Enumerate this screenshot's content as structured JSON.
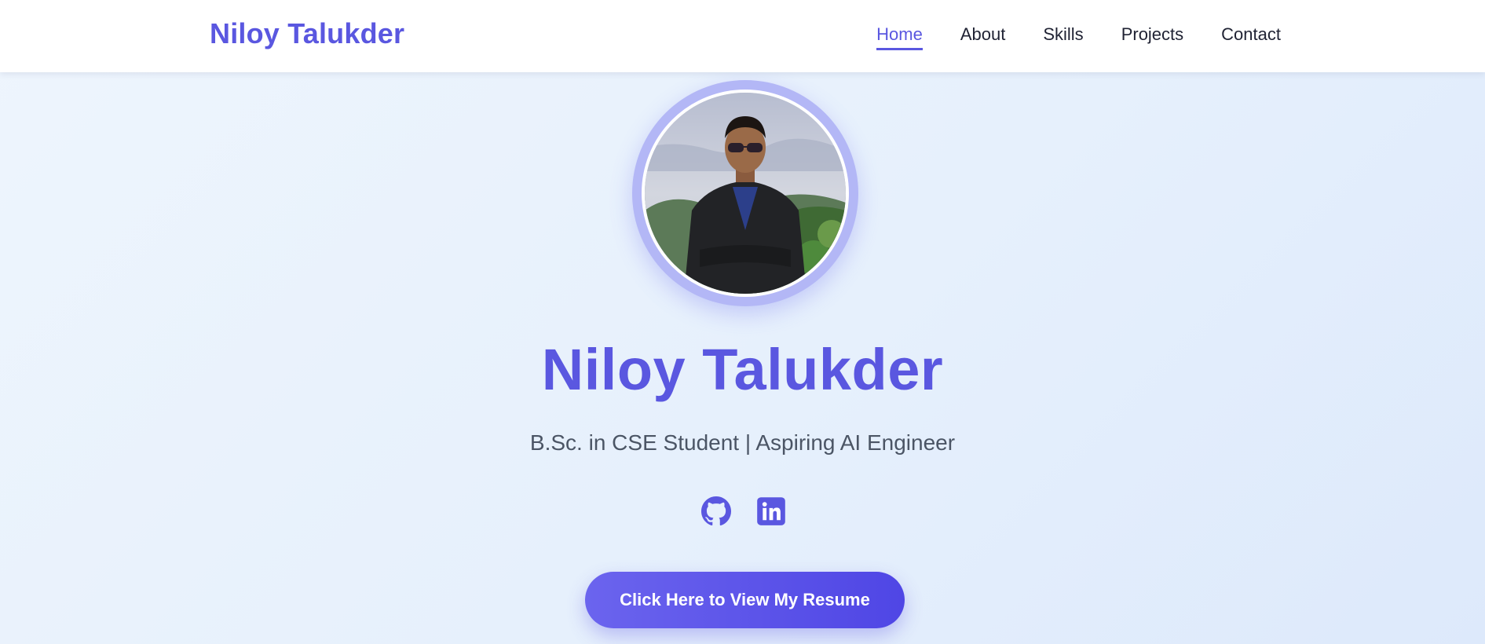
{
  "navbar": {
    "brand": "Niloy Talukder",
    "links": [
      {
        "label": "Home",
        "active": true
      },
      {
        "label": "About"
      },
      {
        "label": "Skills"
      },
      {
        "label": "Projects"
      },
      {
        "label": "Contact"
      }
    ]
  },
  "hero": {
    "name": "Niloy Talukder",
    "subtitle": "B.Sc. in CSE Student | Aspiring AI Engineer",
    "socials": [
      {
        "icon": "github-icon"
      },
      {
        "icon": "linkedin-icon"
      }
    ],
    "resume_button": "Click Here to View My Resume"
  },
  "colors": {
    "accent": "#5a57e0",
    "button_start": "#6b64ee",
    "button_end": "#4f46e5",
    "text": "#1f2233",
    "subtitle": "#4b5565"
  }
}
